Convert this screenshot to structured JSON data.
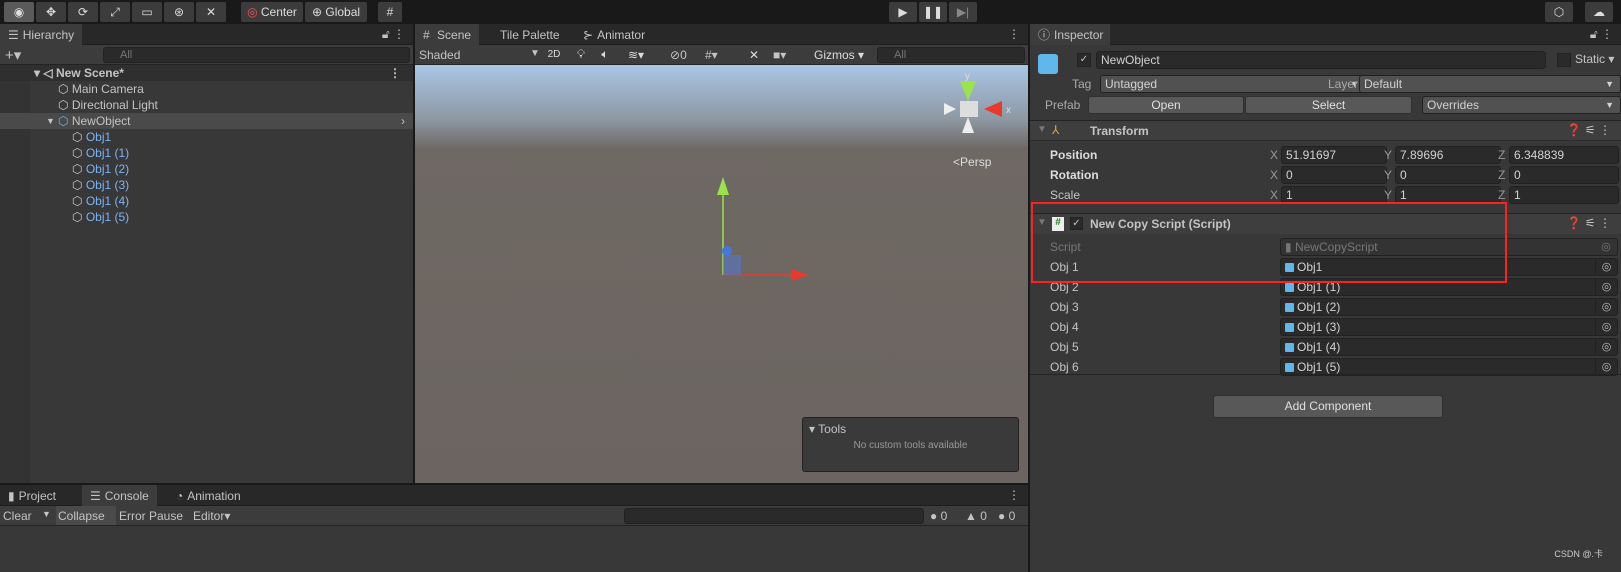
{
  "toolbar": {
    "tools": [
      "view-tool",
      "move-tool",
      "rotate-tool",
      "scale-tool",
      "rect-tool",
      "transform-tool",
      "custom-tool"
    ],
    "pivot": "Center",
    "space": "Global"
  },
  "hierarchy": {
    "tab": "Hierarchy",
    "search_placeholder": "All",
    "scene": "New Scene*",
    "items": [
      {
        "label": "Main Camera",
        "depth": 1,
        "selected": false,
        "color": "#c4c4c4"
      },
      {
        "label": "Directional Light",
        "depth": 1,
        "selected": false,
        "color": "#c4c4c4"
      },
      {
        "label": "NewObject",
        "depth": 1,
        "selected": true,
        "color": "#c4c4c4"
      },
      {
        "label": "Obj1",
        "depth": 2,
        "selected": false,
        "color": "#7cb3f5"
      },
      {
        "label": "Obj1 (1)",
        "depth": 2,
        "selected": false,
        "color": "#7cb3f5"
      },
      {
        "label": "Obj1 (2)",
        "depth": 2,
        "selected": false,
        "color": "#7cb3f5"
      },
      {
        "label": "Obj1 (3)",
        "depth": 2,
        "selected": false,
        "color": "#7cb3f5"
      },
      {
        "label": "Obj1 (4)",
        "depth": 2,
        "selected": false,
        "color": "#7cb3f5"
      },
      {
        "label": "Obj1 (5)",
        "depth": 2,
        "selected": false,
        "color": "#7cb3f5"
      }
    ]
  },
  "scene": {
    "tabs": [
      "Scene",
      "Tile Palette",
      "Animator"
    ],
    "shading": "Shaded",
    "mode2d": "2D",
    "hidden_count": "0",
    "gizmos": "Gizmos",
    "search_placeholder": "All",
    "persp": "Persp",
    "axis_y": "y",
    "axis_x": "x",
    "tools_title": "Tools",
    "tools_msg": "No custom tools available"
  },
  "bottom": {
    "tabs": [
      "Project",
      "Console",
      "Animation"
    ],
    "clear": "Clear",
    "collapse": "Collapse",
    "error_pause": "Error Pause",
    "editor": "Editor",
    "counts": [
      "0",
      "0",
      "0"
    ]
  },
  "inspector": {
    "tab": "Inspector",
    "name": "NewObject",
    "static": "Static",
    "tag_label": "Tag",
    "tag": "Untagged",
    "layer_label": "Layer",
    "layer": "Default",
    "prefab_label": "Prefab",
    "open": "Open",
    "select": "Select",
    "overrides": "Overrides",
    "transform": {
      "title": "Transform",
      "rows": [
        {
          "label": "Position",
          "x": "51.91697",
          "y": "7.89696",
          "z": "6.348839"
        },
        {
          "label": "Rotation",
          "x": "0",
          "y": "0",
          "z": "0"
        },
        {
          "label": "Scale",
          "x": "1",
          "y": "1",
          "z": "1"
        }
      ]
    },
    "script": {
      "title": "New Copy Script (Script)",
      "script_label": "Script",
      "script_value": "NewCopyScript",
      "fields": [
        {
          "label": "Obj 1",
          "value": "Obj1"
        },
        {
          "label": "Obj 2",
          "value": "Obj1 (1)"
        },
        {
          "label": "Obj 3",
          "value": "Obj1 (2)"
        },
        {
          "label": "Obj 4",
          "value": "Obj1 (3)"
        },
        {
          "label": "Obj 5",
          "value": "Obj1 (4)"
        },
        {
          "label": "Obj 6",
          "value": "Obj1 (5)"
        }
      ]
    },
    "add_component": "Add Component"
  },
  "highlight_color": "#ff2020",
  "watermark": "CSDN @.卡"
}
